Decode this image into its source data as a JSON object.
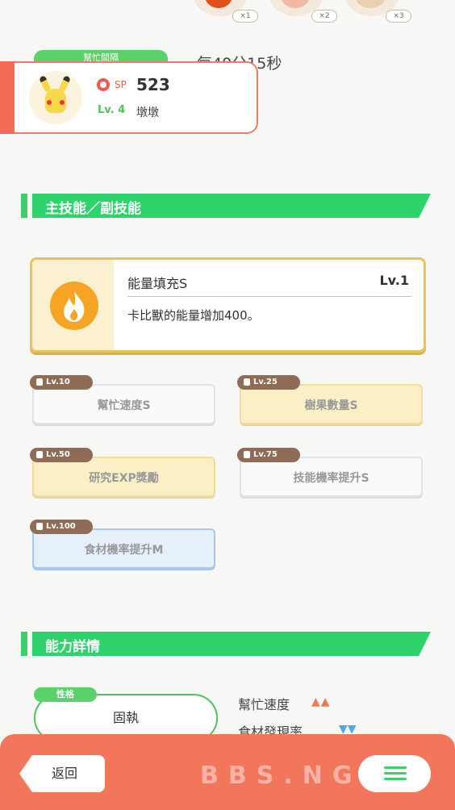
{
  "top_items": [
    {
      "count": "×1"
    },
    {
      "count": "×2"
    },
    {
      "count": "×3"
    }
  ],
  "helper_tag": "幫忙間隔",
  "timer": "每40分15秒",
  "pokemon": {
    "sp_label": "SP",
    "sp_value": "523",
    "level": "Lv. 4",
    "name": "墩墩"
  },
  "section_skills": {
    "title": "主技能／副技能"
  },
  "main_skill": {
    "name": "能量填充S",
    "level": "Lv.1",
    "description": "卡比獸的能量增加400。"
  },
  "sub_skills": [
    {
      "unlock": "Lv.10",
      "name": "幫忙速度S",
      "style": "white"
    },
    {
      "unlock": "Lv.25",
      "name": "樹果數量S",
      "style": "gold"
    },
    {
      "unlock": "Lv.50",
      "name": "研究EXP獎勵",
      "style": "gold"
    },
    {
      "unlock": "Lv.75",
      "name": "技能機率提升S",
      "style": "white"
    },
    {
      "unlock": "Lv.100",
      "name": "食材機率提升M",
      "style": "blue"
    }
  ],
  "section_ability": {
    "title": "能力詳情"
  },
  "nature": {
    "tag": "性格",
    "value": "固執"
  },
  "abilities": [
    {
      "name": "幫忙速度",
      "arrows": "▲▲"
    },
    {
      "name": "食材發現率",
      "arrows": "▼▼"
    }
  ],
  "bottom": {
    "back_label": "返回"
  },
  "watermark": "BBS.NGA",
  "colors": {
    "accent_green": "#2ed36b",
    "bottom_bar": "#f2765c",
    "gold_border": "#e9c45a"
  }
}
